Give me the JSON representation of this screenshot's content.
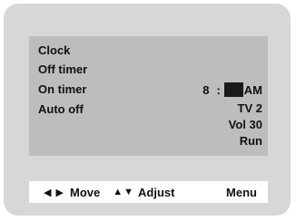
{
  "menu": {
    "items": [
      {
        "label": "Clock"
      },
      {
        "label": "Off timer"
      },
      {
        "label": "On timer"
      },
      {
        "label": "Auto off"
      }
    ]
  },
  "on_timer": {
    "hour": "8",
    "separator": ":",
    "ampm": "AM",
    "channel": "TV 2",
    "volume": "Vol 30",
    "mode": "Run"
  },
  "footer": {
    "move_arrows": "◀ ▶",
    "move_label": "Move",
    "adjust_arrows": "▲▼",
    "adjust_label": "Adjust",
    "menu_label": "Menu"
  }
}
